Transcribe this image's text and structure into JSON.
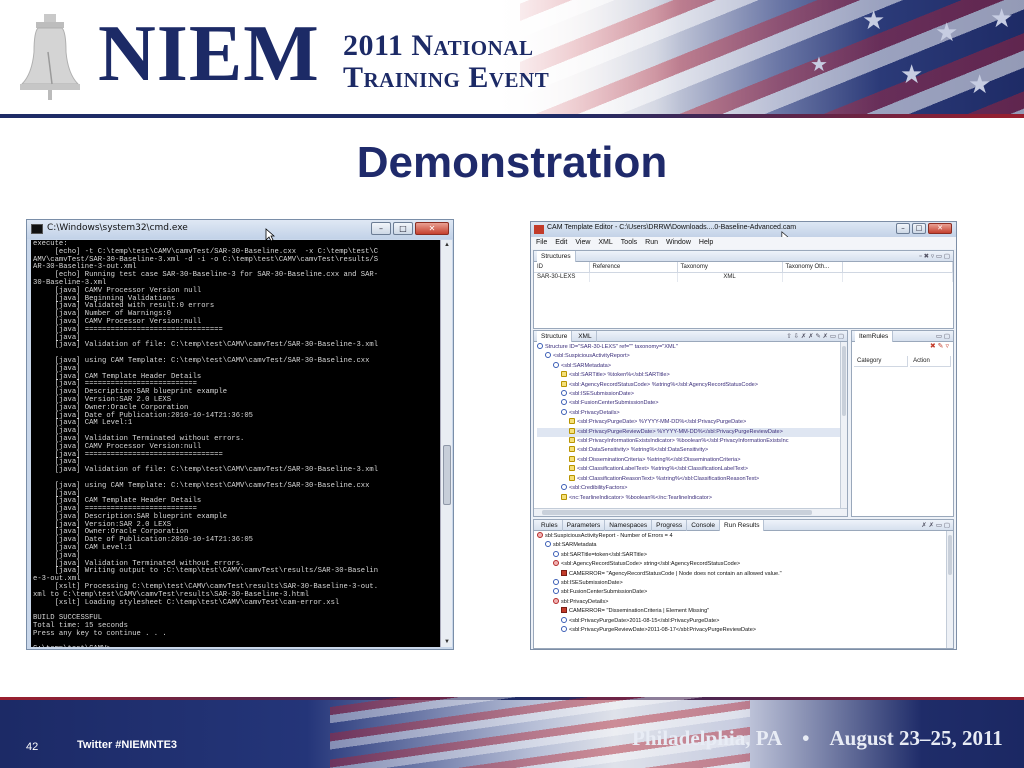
{
  "header": {
    "logo_text": "NIEM",
    "event_line1": "2011 National",
    "event_line2": "Training Event"
  },
  "slide": {
    "title": "Demonstration",
    "page_number": "42",
    "twitter": "Twitter #NIEMNTE3",
    "location": "Philadelphia, PA",
    "separator": "•",
    "dates": "August 23–25, 2011"
  },
  "cmd_window": {
    "title": "C:\\Windows\\system32\\cmd.exe",
    "buttons": {
      "minimize": "–",
      "maximize": "□",
      "close": "✕"
    },
    "lines": [
      "execute:",
      "     [echo] -t C:\\temp\\test\\CAMV\\camvTest/SAR-30-Baseline.cxx  -x C:\\temp\\test\\C",
      "AMV\\camvTest/SAR-30-Baseline-3.xml -d -i -o C:\\temp\\test\\CAMV\\camvTest\\results/S",
      "AR-30-Baseline-3-out.xml",
      "     [echo] Running test case SAR-30-Baseline-3 for SAR-30-Baseline.cxx and SAR-",
      "30-Baseline-3.xml",
      "     [java] CAMV Processor Version null",
      "     [java] Beginning Validations",
      "     [java] Validated with result:0 errors",
      "     [java] Number of Warnings:0",
      "     [java] CAMV Processor Version:null",
      "     [java] ================================",
      "     [java]",
      "     [java] Validation of file: C:\\temp\\test\\CAMV\\camvTest/SAR-30-Baseline-3.xml",
      "",
      "     [java] using CAM Template: C:\\temp\\test\\CAMV\\camvTest/SAR-30-Baseline.cxx",
      "     [java]",
      "     [java] CAM Template Header Details",
      "     [java] ==========================",
      "     [java] Description:SAR blueprint example",
      "     [java] Version:SAR 2.0 LEXS",
      "     [java] Owner:Oracle Corporation",
      "     [java] Date of Publication:2010-10-14T21:36:05",
      "     [java] CAM Level:1",
      "     [java]",
      "     [java] Validation Terminated without errors.",
      "     [java] CAMV Processor Version:null",
      "     [java] ================================",
      "     [java]",
      "     [java] Validation of file: C:\\temp\\test\\CAMV\\camvTest/SAR-30-Baseline-3.xml",
      "",
      "     [java] using CAM Template: C:\\temp\\test\\CAMV\\camvTest/SAR-30-Baseline.cxx",
      "     [java]",
      "     [java] CAM Template Header Details",
      "     [java] ==========================",
      "     [java] Description:SAR blueprint example",
      "     [java] Version:SAR 2.0 LEXS",
      "     [java] Owner:Oracle Corporation",
      "     [java] Date of Publication:2010-10-14T21:36:05",
      "     [java] CAM Level:1",
      "     [java]",
      "     [java] Validation Terminated without errors.",
      "     [java] Writing output to :C:\\temp\\test\\CAMV\\camvTest\\results/SAR-30-Baselin",
      "e-3-out.xml",
      "     [xslt] Processing C:\\temp\\test\\CAMV\\camvTest\\results\\SAR-30-Baseline-3-out.",
      "xml to C:\\temp\\test\\CAMV\\camvTest\\results\\SAR-30-Baseline-3.html",
      "     [xslt] Loading stylesheet C:\\temp\\test\\CAMV\\camvTest\\cam-error.xsl",
      "",
      "BUILD SUCCESSFUL",
      "Total time: 15 seconds",
      "Press any key to continue . . .",
      "",
      "C:\\temp\\test\\CAMV>"
    ]
  },
  "cam_window": {
    "title": "CAM Template Editor - C:\\Users\\DRRW\\Downloads....0-Baseline-Advanced.cam",
    "menu": [
      "File",
      "Edit",
      "View",
      "XML",
      "Tools",
      "Run",
      "Window",
      "Help"
    ],
    "structures_tab": "Structures",
    "structures_columns": [
      "ID",
      "Reference",
      "Taxonomy",
      "Taxonomy Oth..."
    ],
    "structures_row": {
      "id": "SAR-30-LEXS",
      "reference": "",
      "taxonomy": "XML",
      "other": ""
    },
    "structure_tab": "Structure",
    "xml_tab": "XML",
    "itemrules_tab": "ItemRules",
    "itemrules_columns": [
      "Category",
      "Action"
    ],
    "tree": [
      {
        "text": "Structure ID=\"SAR-30-LEXS\" ref=\"\" taxonomy=\"XML\"",
        "icon": "b",
        "indent": 0
      },
      {
        "text": "<sbl:SuspiciousActivityReport>",
        "icon": "b",
        "indent": 1
      },
      {
        "text": "<sbl:SARMetadata>",
        "icon": "b",
        "indent": 2
      },
      {
        "text": "<sbl:SARTitle> %token%</sbl:SARTitle>",
        "icon": "y",
        "indent": 3
      },
      {
        "text": "<sbl:AgencyRecordStatusCode> %string%</sbl:AgencyRecordStatusCode>",
        "icon": "y",
        "indent": 3
      },
      {
        "text": "<sbl:ISESubmissionDate>",
        "icon": "b",
        "indent": 3
      },
      {
        "text": "<sbl:FusionCenterSubmissionDate>",
        "icon": "b",
        "indent": 3
      },
      {
        "text": "<sbl:PrivacyDetails>",
        "icon": "b",
        "indent": 3
      },
      {
        "text": "<sbl:PrivacyPurgeDate> %YYYY-MM-DD%</sbl:PrivacyPurgeDate>",
        "icon": "y",
        "indent": 4
      },
      {
        "text": "<sbl:PrivacyPurgeReviewDate> %YYYY-MM-DD%</sbl:PrivacyPurgeReviewDate>",
        "icon": "y",
        "indent": 4,
        "selected": true
      },
      {
        "text": "<sbl:PrivacyInformationExistsIndicator> %boolean%</sbl:PrivacyInformationExistsInc",
        "icon": "y",
        "indent": 4
      },
      {
        "text": "<sbl:DataSensitivity> %string%</sbl:DataSensitivity>",
        "icon": "y",
        "indent": 4
      },
      {
        "text": "<sbl:DisseminationCriteria> %string%</sbl:DisseminationCriteria>",
        "icon": "y",
        "indent": 4
      },
      {
        "text": "<sbl:ClassificationLabelText> %string%</sbl:ClassificationLabelText>",
        "icon": "y",
        "indent": 4
      },
      {
        "text": "<sbl:ClassificationReasonText> %string%</sbl:ClassificationReasonText>",
        "icon": "y",
        "indent": 4
      },
      {
        "text": "<sbl:CredibilityFactors>",
        "icon": "b",
        "indent": 3
      },
      {
        "text": "<nc:TearlineIndicator> %boolean%</nc:TearlineIndicator>",
        "icon": "y",
        "indent": 3
      }
    ],
    "bottom_tabs": [
      "Rules",
      "Parameters",
      "Namespaces",
      "Progress",
      "Console",
      "Run Results"
    ],
    "results": [
      {
        "text": "sbl:SuspiciousActivityReport - Number of Errors = 4",
        "icon": "r",
        "indent": 0,
        "dark": true
      },
      {
        "text": "sbl:SARMetadata",
        "icon": "b",
        "indent": 1,
        "dark": true
      },
      {
        "text": "sbl:SARTitle=token</sbl:SARTitle>",
        "icon": "b",
        "indent": 2,
        "dark": true
      },
      {
        "text": "<sbl:AgencyRecordStatusCode> string</sbl:AgencyRecordStatusCode>",
        "icon": "r",
        "indent": 2,
        "dark": true
      },
      {
        "text": "CAMERROR= \"AgencyRecordStatusCode | Node does not contain an allowed value.\"",
        "icon": "err",
        "indent": 3,
        "dark": true
      },
      {
        "text": "sbl:ISESubmissionDate>",
        "icon": "b",
        "indent": 2,
        "dark": true
      },
      {
        "text": "sbl:FusionCenterSubmissionDate>",
        "icon": "b",
        "indent": 2,
        "dark": true
      },
      {
        "text": "sbl:PrivacyDetails>",
        "icon": "r",
        "indent": 2,
        "dark": true
      },
      {
        "text": "CAMERROR= \"DisseminationCriteria | Element Missing\"",
        "icon": "err",
        "indent": 3,
        "dark": true
      },
      {
        "text": "<sbl:PrivacyPurgeDate>2011-08-15</sbl:PrivacyPurgeDate>",
        "icon": "b",
        "indent": 3,
        "dark": true
      },
      {
        "text": "<sbl:PrivacyPurgeReviewDate>2011-08-17</sbl:PrivacyPurgeReviewDate>",
        "icon": "b",
        "indent": 3,
        "dark": true
      }
    ]
  },
  "colors": {
    "brand_navy": "#1c2a66",
    "flag_red": "#9a1f2e",
    "console_bg": "#000000"
  }
}
